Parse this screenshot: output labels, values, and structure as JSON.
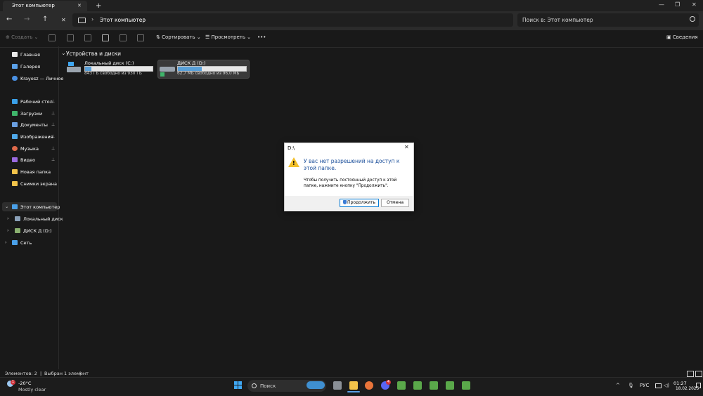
{
  "window": {
    "tab_title": "Этот компьютер",
    "new_tab": "+",
    "tab_close": "✕",
    "minimize": "—",
    "maximize": "❐",
    "close": "✕"
  },
  "nav": {
    "back": "←",
    "forward": "→",
    "up": "↑",
    "stop": "✕",
    "address_chevron": "›",
    "address_text": "Этот компьютер",
    "search_placeholder": "Поиск в: Этот компьютер"
  },
  "toolbar": {
    "create": "Создать",
    "sort": "Сортировать",
    "view": "Просмотреть",
    "more": "•••",
    "details": "Сведения"
  },
  "sidebar": {
    "items": [
      {
        "label": "Главная",
        "icon": "home-icon",
        "color": "#e8e8e8"
      },
      {
        "label": "Галерея",
        "icon": "gallery-icon",
        "color": "#5aa0e8"
      },
      {
        "label": "Krayosz — Личное",
        "icon": "onedrive-icon",
        "color": "#4a90e2"
      },
      {
        "label": "Рабочий стол",
        "icon": "desktop-icon",
        "color": "#3aa0e8"
      },
      {
        "label": "Загрузки",
        "icon": "downloads-icon",
        "color": "#3fb56b"
      },
      {
        "label": "Документы",
        "icon": "documents-icon",
        "color": "#6a9fe0"
      },
      {
        "label": "Изображения",
        "icon": "pictures-icon",
        "color": "#4fa8e8"
      },
      {
        "label": "Музыка",
        "icon": "music-icon",
        "color": "#e06a4a"
      },
      {
        "label": "Видео",
        "icon": "videos-icon",
        "color": "#9a6ae0"
      },
      {
        "label": "Новая папка",
        "icon": "folder-icon",
        "color": "#f2c34a"
      },
      {
        "label": "Снимки экрана",
        "icon": "folder-icon",
        "color": "#f2c34a"
      },
      {
        "label": "Этот компьютер",
        "icon": "computer-icon",
        "color": "#4aa0e8"
      },
      {
        "label": "Локальный диск",
        "icon": "disk-icon",
        "color": "#8aa0b8"
      },
      {
        "label": "ДИСК Д (D:)",
        "icon": "disk-icon",
        "color": "#8ab070"
      },
      {
        "label": "Сеть",
        "icon": "network-icon",
        "color": "#4aa0e8"
      }
    ],
    "pin_glyph": "📌",
    "expand_chevron": "›",
    "collapse_chevron": "⌄"
  },
  "main": {
    "section_title": "Устройства и диски",
    "section_chevron": "⌄",
    "drives": [
      {
        "name": "Локальный диск (C:)",
        "free_text": "843 ГБ свободно из 930 ГБ",
        "used_fraction": 0.094
      },
      {
        "name": "ДИСК Д (D:)",
        "free_text": "62,7 МБ свободно из 96,0 МБ",
        "used_fraction": 0.347
      }
    ]
  },
  "dialog": {
    "title": "D:\\",
    "close": "✕",
    "main_text": "У вас нет разрешений на доступ к этой папке.",
    "sub_text": "Чтобы получить постоянный доступ к этой папке, нажмите кнопку \"Продолжить\".",
    "continue_label": "Продолжить",
    "cancel_label": "Отмена",
    "warn_glyph": "!"
  },
  "status": {
    "items_count": "Элементов: 2",
    "selected": "Выбран 1 элемент"
  },
  "taskbar": {
    "weather_temp": "-20°C",
    "weather_desc": "Mostly clear",
    "weather_badge": "1",
    "search_label": "Поиск",
    "tray_up": "^",
    "language": "РУС",
    "time": "01:27",
    "date": "18.02.2025",
    "discord_badge": "4"
  },
  "colors": {
    "accent": "#0078d4",
    "drive_bar_fill": "#5aa0d8",
    "warning": "#f2c02b"
  }
}
